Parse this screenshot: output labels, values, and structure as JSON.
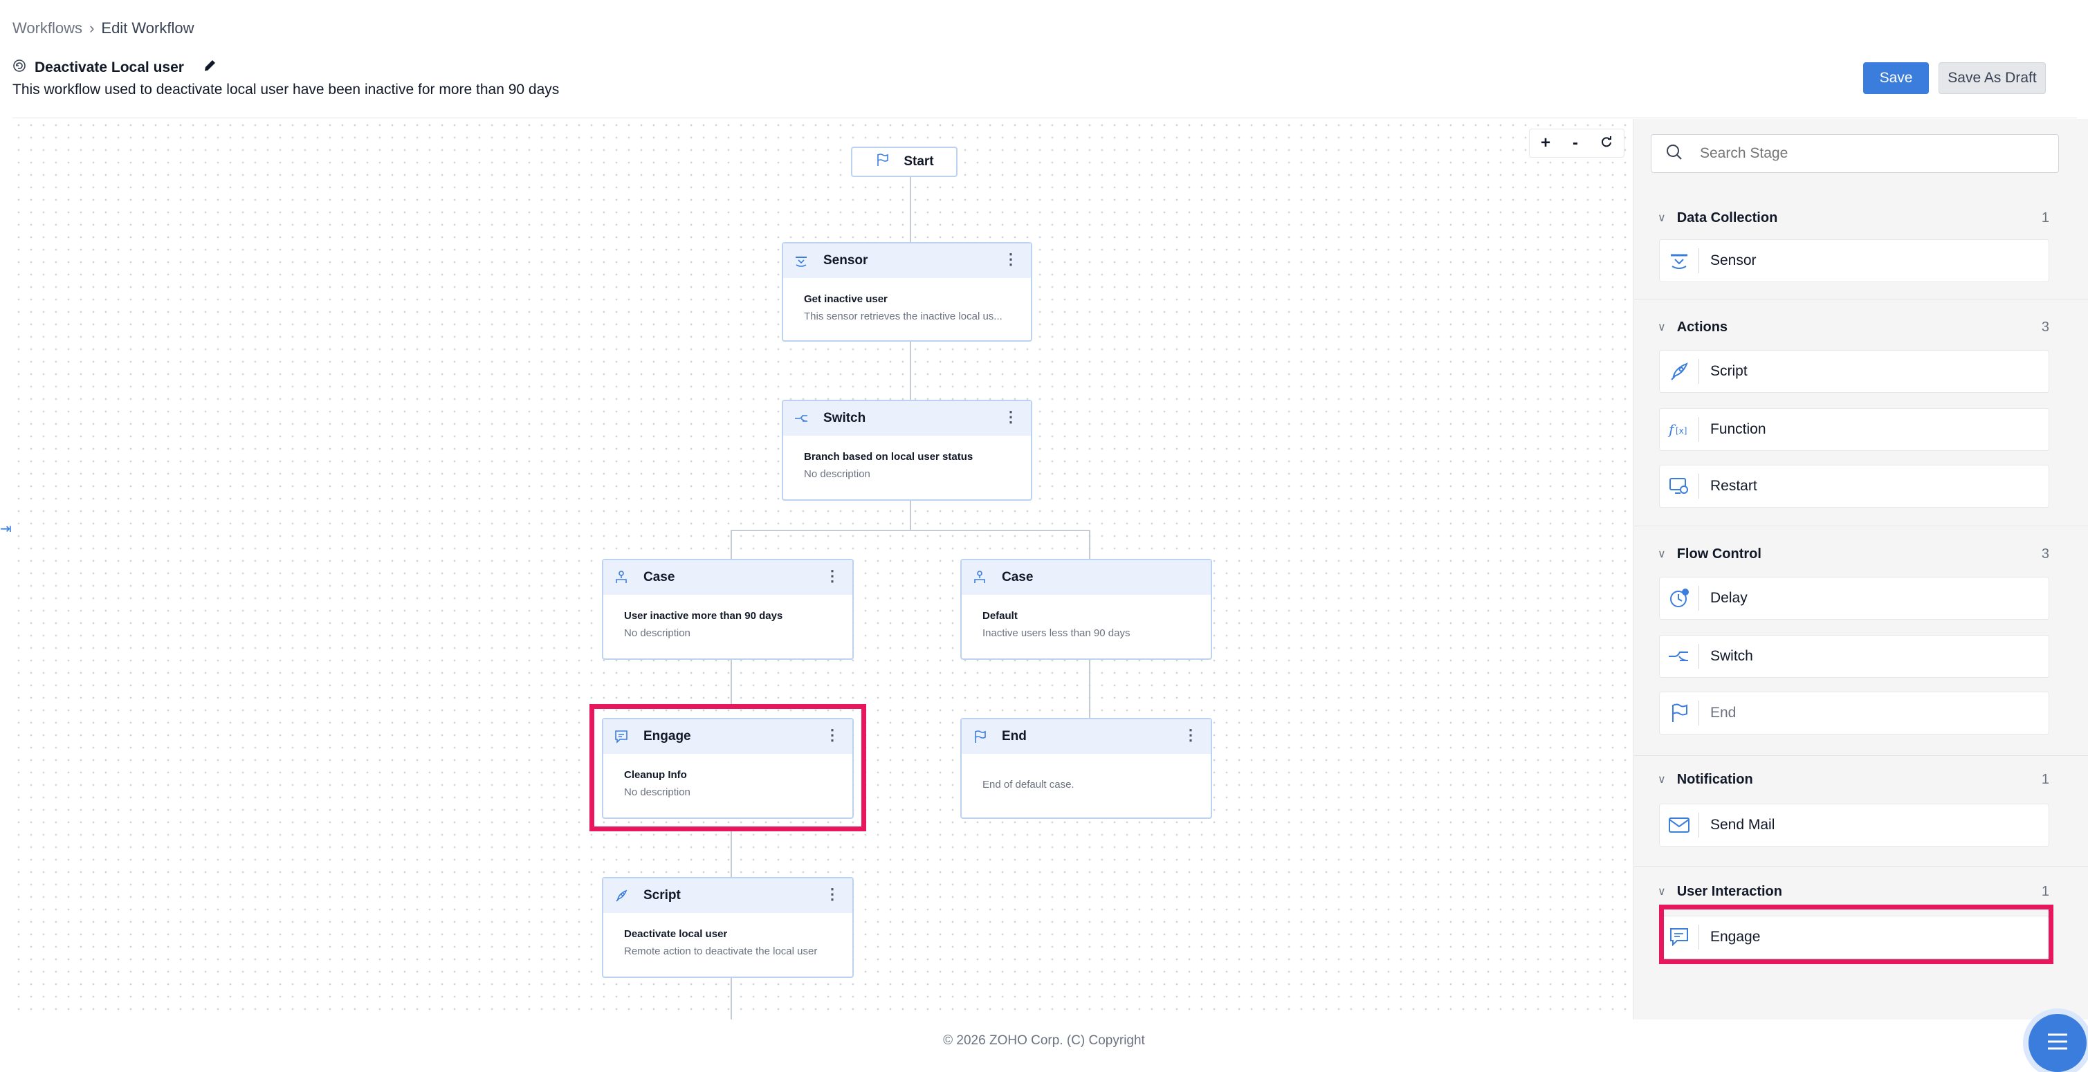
{
  "breadcrumb": {
    "parent": "Workflows",
    "current": "Edit Workflow"
  },
  "workflow": {
    "title": "Deactivate Local user",
    "description": "This workflow used to deactivate local user have been inactive for more than 90 days"
  },
  "actions": {
    "save": "Save",
    "save_draft": "Save As Draft"
  },
  "zoom": {
    "plus": "+",
    "minus": "-"
  },
  "canvas": {
    "start": "Start",
    "nodes": {
      "sensor": {
        "type": "Sensor",
        "title": "Get inactive user",
        "desc": "This sensor retrieves the inactive local us..."
      },
      "switch": {
        "type": "Switch",
        "title": "Branch based on local user status",
        "desc": "No description"
      },
      "case1": {
        "type": "Case",
        "title": "User inactive more than 90 days",
        "desc": "No description"
      },
      "case2": {
        "type": "Case",
        "title": "Default",
        "desc": "Inactive users less than 90 days"
      },
      "engage": {
        "type": "Engage",
        "title": "Cleanup Info",
        "desc": "No description"
      },
      "end": {
        "type": "End",
        "desc": "End of default case."
      },
      "script": {
        "type": "Script",
        "title": "Deactivate local user",
        "desc": "Remote action to deactivate the local user"
      }
    }
  },
  "panel": {
    "search_placeholder": "Search Stage",
    "sections": {
      "data_collection": {
        "title": "Data Collection",
        "count": "1",
        "items": [
          "Sensor"
        ]
      },
      "actions": {
        "title": "Actions",
        "count": "3",
        "items": [
          "Script",
          "Function",
          "Restart"
        ]
      },
      "flow_control": {
        "title": "Flow Control",
        "count": "3",
        "items": [
          "Delay",
          "Switch",
          "End"
        ]
      },
      "notification": {
        "title": "Notification",
        "count": "1",
        "items": [
          "Send Mail"
        ]
      },
      "user_interaction": {
        "title": "User Interaction",
        "count": "1",
        "items": [
          "Engage"
        ]
      }
    }
  },
  "footer": "© 2026 ZOHO Corp. (C) Copyright",
  "colors": {
    "accent": "#3b7ddd",
    "highlight": "#e8175d",
    "node_header": "#eaf1fc"
  }
}
